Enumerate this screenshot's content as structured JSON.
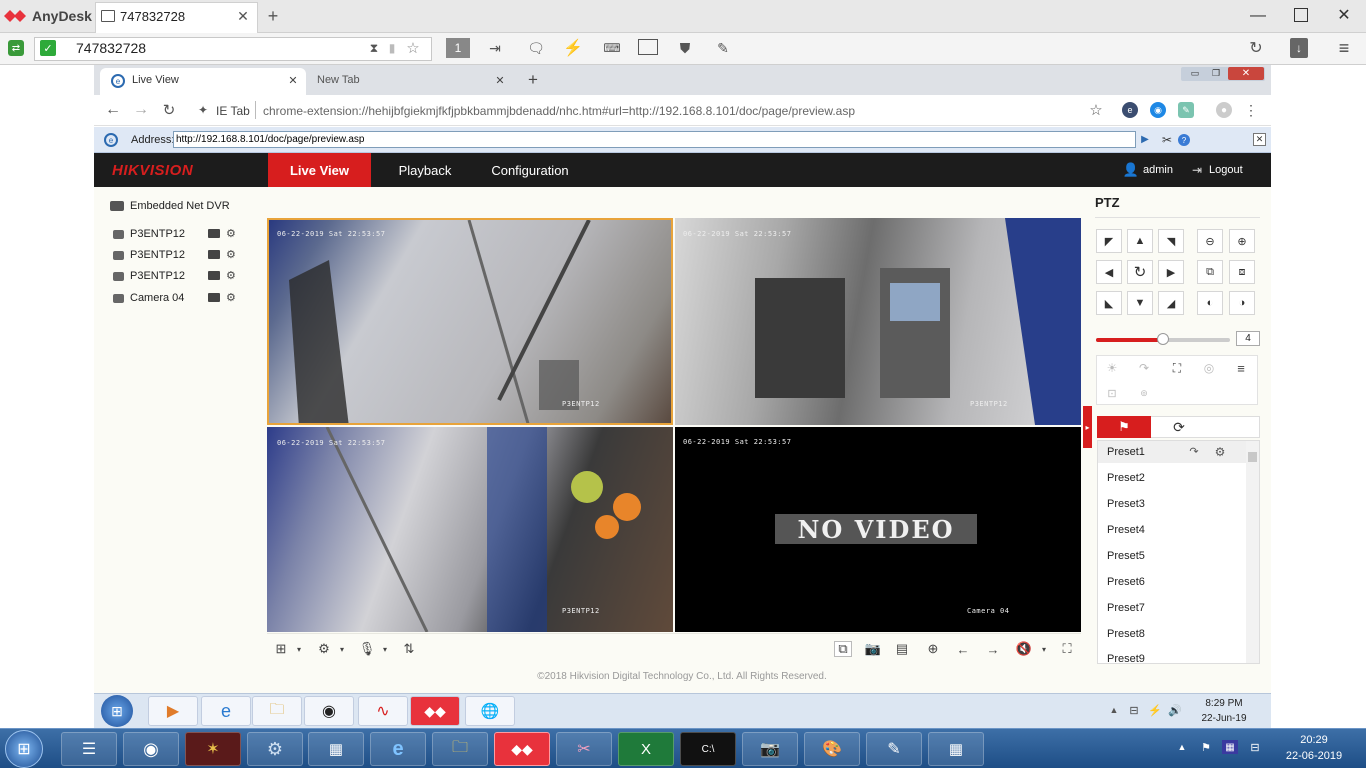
{
  "anydesk": {
    "app_name": "AnyDesk",
    "tab_title": "747832728",
    "address": "747832728",
    "display_number": "1"
  },
  "chrome": {
    "tabs": [
      {
        "label": "Live View"
      },
      {
        "label": "New Tab"
      }
    ],
    "ie_tab_label": "IE Tab",
    "url": "chrome-extension://hehijbfgiekmjfkfjpbkbammjbdenadd/nhc.htm#url=http://192.168.8.101/doc/page/preview.asp",
    "address_label": "Address:",
    "address_value": "http://192.168.8.101/doc/page/preview.asp"
  },
  "hik": {
    "logo": "HIKVISION",
    "nav": [
      "Live View",
      "Playback",
      "Configuration"
    ],
    "user": "admin",
    "logout": "Logout",
    "device": "Embedded Net DVR",
    "cameras": [
      "P3ENTP12",
      "P3ENTP12",
      "P3ENTP12",
      "Camera 04"
    ],
    "no_video": "NO VIDEO",
    "osd_date": "06-22-2019 Sat 22:53:57",
    "osd_cam4": "Camera 04",
    "osd_name": "P3ENTP12",
    "copyright": "©2018 Hikvision Digital Technology Co., Ltd. All Rights Reserved.",
    "ptz_title": "PTZ",
    "speed_value": "4",
    "speed_fraction": 0.5,
    "presets": [
      "Preset1",
      "Preset2",
      "Preset3",
      "Preset4",
      "Preset5",
      "Preset6",
      "Preset7",
      "Preset8",
      "Preset9"
    ]
  },
  "inner_tray": {
    "time": "8:29 PM",
    "date": "22-Jun-19"
  },
  "tray": {
    "time": "20:29",
    "date": "22-06-2019"
  },
  "colors": {
    "hik_red": "#d71e1e",
    "nav_bg": "#1c1c1c",
    "selected_border": "#e8a33a",
    "anydesk_red": "#e8323c"
  }
}
